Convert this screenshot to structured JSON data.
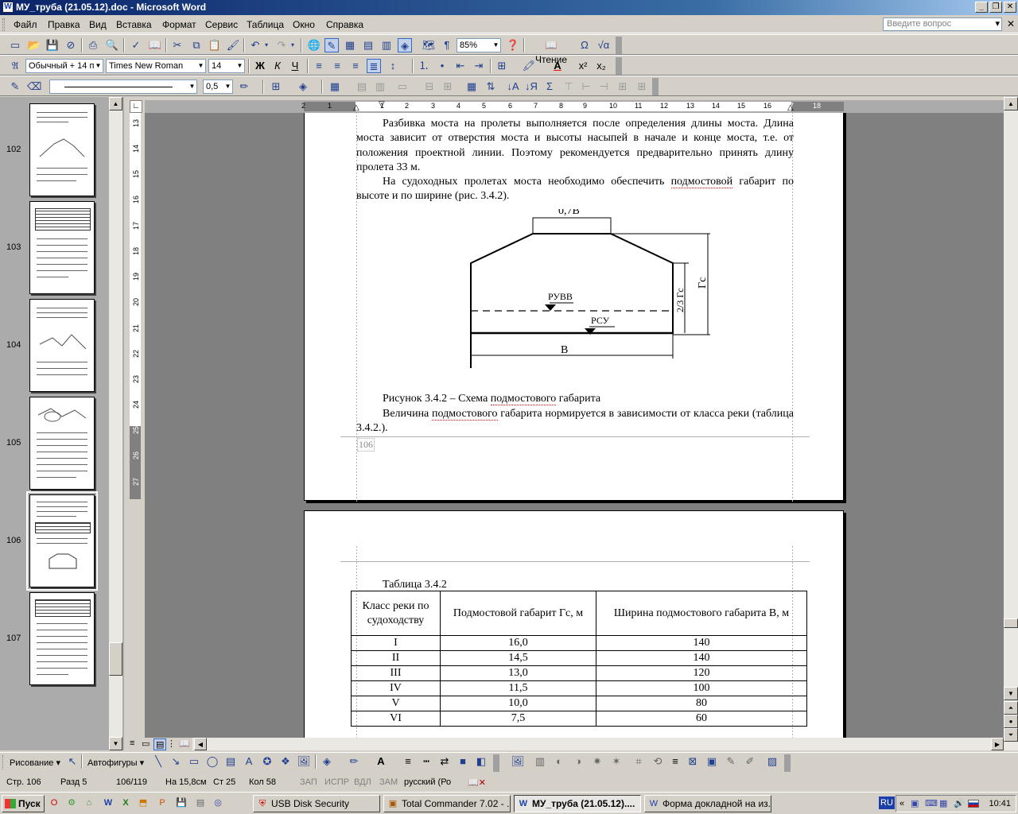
{
  "window": {
    "title": "МУ_труба (21.05.12).doc - Microsoft Word"
  },
  "menu": {
    "items": [
      "Файл",
      "Правка",
      "Вид",
      "Вставка",
      "Формат",
      "Сервис",
      "Таблица",
      "Окно",
      "Справка"
    ],
    "ask_placeholder": "Введите вопрос"
  },
  "toolbar": {
    "zoom": "85%",
    "reading": "Чтение",
    "style": "Обычный + 14 п",
    "font": "Times New Roman",
    "size": "14",
    "line_width": "0,5"
  },
  "thumbnails": [
    "102",
    "103",
    "104",
    "105",
    "106",
    "107"
  ],
  "ruler": {
    "h_ticks": [
      "2",
      "1",
      "1",
      "2",
      "3",
      "4",
      "5",
      "6",
      "7",
      "8",
      "9",
      "10",
      "11",
      "12",
      "13",
      "14",
      "15",
      "16",
      "17",
      "18"
    ],
    "v_ticks": [
      "13",
      "14",
      "15",
      "16",
      "17",
      "18",
      "19",
      "20",
      "21",
      "22",
      "23",
      "24",
      "25",
      "26",
      "27"
    ]
  },
  "page1": {
    "para1": "Разбивка моста на пролеты выполняется после определения длины моста. Длина моста зависит от отверстия моста и высоты насыпей в начале и конце моста, т.е. от положения проектной линии. Поэтому рекомендуется предварительно принять длину пролета 33 м.",
    "para2_a": "На судоходных пролетах моста необходимо обеспечить ",
    "para2_u": "подмостовой",
    "para2_b": " габарит по высоте и по ширине (рис. 3.4.2).",
    "figure": {
      "label_top": "0,7В",
      "label_ruvv": "РУВВ",
      "label_rsu": "РСУ",
      "label_b": "В",
      "label_23": "2/3 Гс",
      "label_g": "Гс"
    },
    "caption_a": "Рисунок 3.4.2 – Схема ",
    "caption_u": "подмостового",
    "caption_b": " габарита",
    "para3_a": "Величина ",
    "para3_u": "подмостового",
    "para3_b": " габарита нормируется в зависимости от класса реки (таблица 3.4.2.).",
    "page_number": "106"
  },
  "page2": {
    "table_title": "Таблица 3.4.2",
    "headers": [
      "Класс реки по судоходству",
      "Подмостовой габарит Гс, м",
      "Ширина подмостового габарита В, м"
    ],
    "rows": [
      [
        "I",
        "16,0",
        "140"
      ],
      [
        "II",
        "14,5",
        "140"
      ],
      [
        "III",
        "13,0",
        "120"
      ],
      [
        "IV",
        "11,5",
        "100"
      ],
      [
        "V",
        "10,0",
        "80"
      ],
      [
        "VI",
        "7,5",
        "60"
      ]
    ]
  },
  "drawing_toolbar": {
    "draw": "Рисование",
    "autoshapes": "Автофигуры"
  },
  "status": {
    "page": "Стр. 106",
    "section": "Разд 5",
    "pages": "106/119",
    "at": "На 15,8см",
    "line": "Ст 25",
    "col": "Кол 58",
    "rec": "ЗАП",
    "trk": "ИСПР",
    "ext": "ВДЛ",
    "ovr": "ЗАМ",
    "lang": "русский (Ро"
  },
  "taskbar": {
    "start": "Пуск",
    "tasks": [
      "USB Disk Security",
      "Total Commander 7.02 - ...",
      "МУ_труба (21.05.12)....",
      "Форма докладной на из..."
    ],
    "lang": "RU",
    "time": "10:41"
  }
}
